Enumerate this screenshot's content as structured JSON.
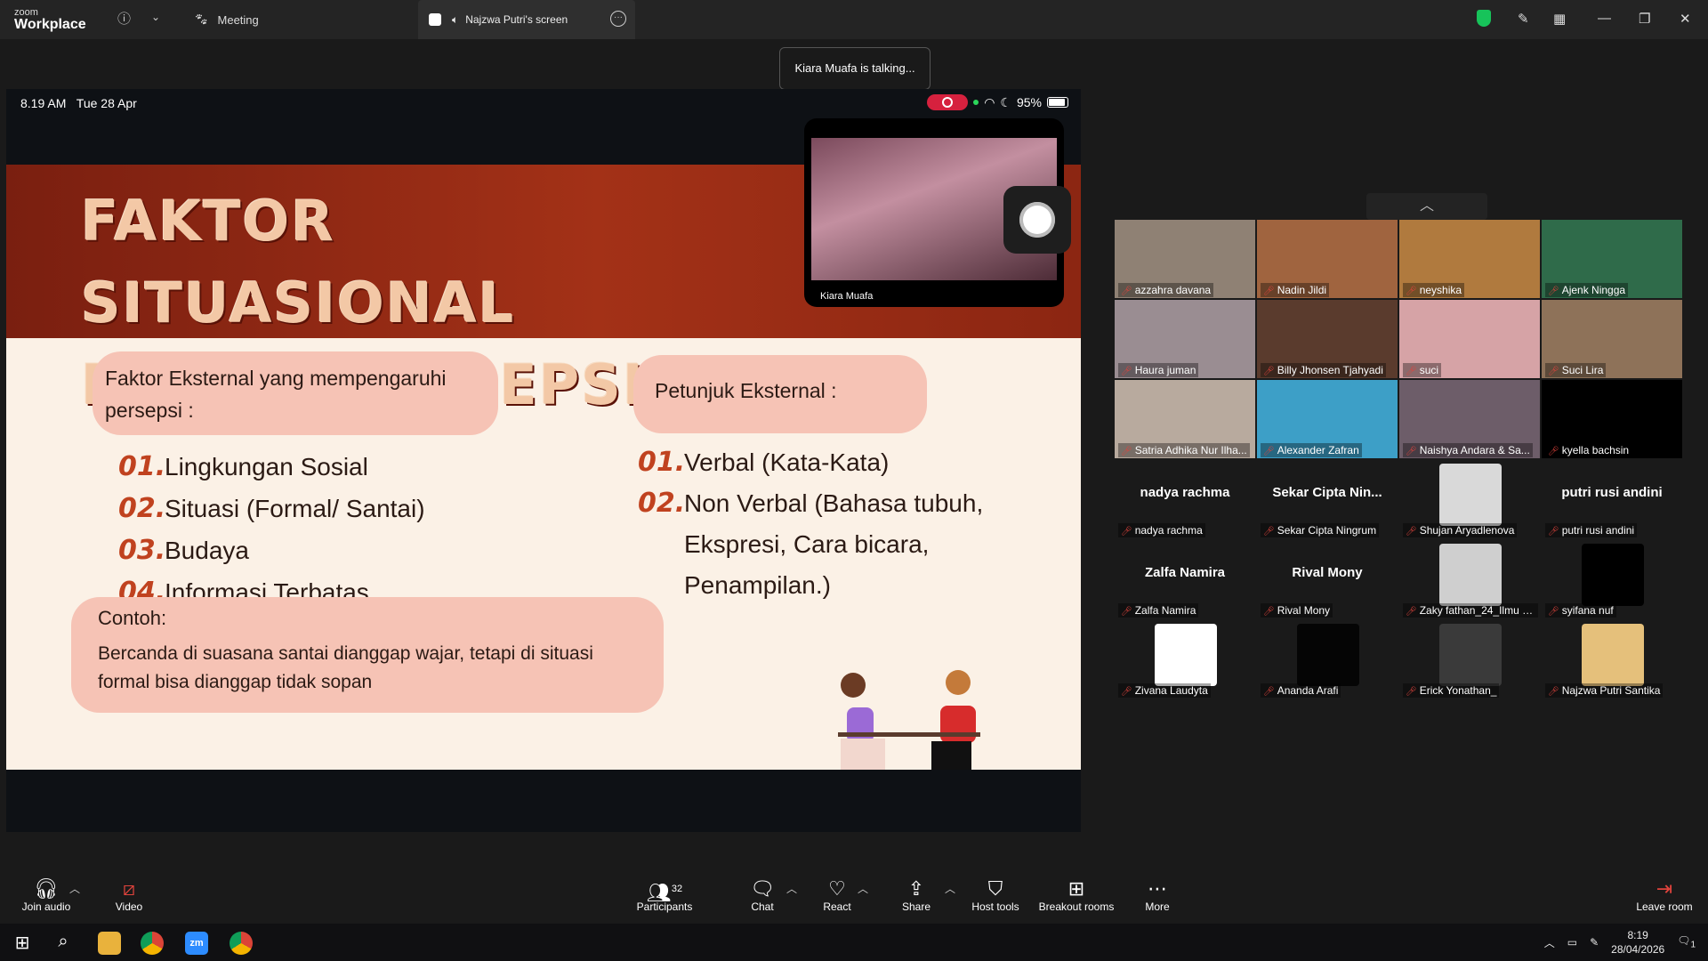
{
  "titlebar": {
    "logo_top": "zoom",
    "logo_bottom": "Workplace",
    "meeting_tab": "Meeting",
    "screen_tab": "Najzwa Putri's screen",
    "info_icon": "info-icon",
    "chevron_icon": "chevron-down-icon"
  },
  "toast": "Kiara Muafa is talking...",
  "share": {
    "time": "8.19 AM",
    "date": "Tue 28 Apr",
    "battery": "95%",
    "slide": {
      "title": "Faktor situasional dalam persepsi",
      "pill_left": "Faktor Eksternal yang mempengaruhi persepsi :",
      "pill_right": "Petunjuk Eksternal :",
      "left_items": [
        {
          "num": "01.",
          "text": "Lingkungan Sosial"
        },
        {
          "num": "02.",
          "text": "Situasi (Formal/ Santai)"
        },
        {
          "num": "03.",
          "text": "Budaya"
        },
        {
          "num": "04.",
          "text": "Informasi Terbatas"
        }
      ],
      "right_items": [
        {
          "num": "01.",
          "text": "Verbal (Kata-Kata)"
        },
        {
          "num": "02.",
          "text": "Non Verbal (Bahasa tubuh, Ekspresi, Cara bicara, Penampilan.)"
        }
      ],
      "example_title": "Contoh:",
      "example_text": "Bercanda di suasana santai dianggap wajar, tetapi di situasi formal bisa dianggap tidak sopan"
    },
    "self_view_name": "Kiara Muafa"
  },
  "gallery": [
    {
      "name": "azzahra davana",
      "big": "",
      "color": "#8f8174"
    },
    {
      "name": "Nadin Jildi",
      "big": "",
      "color": "#a0643f"
    },
    {
      "name": "neyshika",
      "big": "",
      "color": "#b07a3e"
    },
    {
      "name": "Ajenk Ningga",
      "big": "",
      "color": "#2f6b4a"
    },
    {
      "name": "Haura juman",
      "big": "",
      "color": "#9a8d92"
    },
    {
      "name": "Billy Jhonsen Tjahyadi",
      "big": "",
      "color": "#5a3b2d"
    },
    {
      "name": "suci",
      "big": "",
      "color": "#d6a3a6"
    },
    {
      "name": "Suci Lira",
      "big": "",
      "color": "#8e7259"
    },
    {
      "name": "Satria Adhika Nur Ilha...",
      "big": "",
      "color": "#b8aa9e"
    },
    {
      "name": "Alexander Zafran",
      "big": "",
      "color": "#3d9fc7"
    },
    {
      "name": "Naishya Andara & Sa...",
      "big": "",
      "color": "#6d5d69"
    },
    {
      "name": "kyella bachsin",
      "big": "",
      "color": "#000000"
    },
    {
      "name": "nadya rachma",
      "big": "nadya rachma",
      "color": "#000000"
    },
    {
      "name": "Sekar Cipta Ningrum",
      "big": "Sekar Cipta Nin...",
      "color": "#000000"
    },
    {
      "name": "Shujan Aryadlenova",
      "big": "",
      "color": "#000000"
    },
    {
      "name": "putri rusi andini",
      "big": "putri rusi andini",
      "color": "#000000"
    },
    {
      "name": "Zalfa Namira",
      "big": "Zalfa Namira",
      "color": "#000000"
    },
    {
      "name": "Rival Mony",
      "big": "Rival Mony",
      "color": "#000000"
    },
    {
      "name": "Zaky fathan_24_Ilmu K...",
      "big": "",
      "color": "#000000"
    },
    {
      "name": "syifana nuf",
      "big": "",
      "color": "#000000"
    },
    {
      "name": "Zivana Laudyta",
      "big": "",
      "color": "#000000"
    },
    {
      "name": "Ananda Arafi",
      "big": "",
      "color": "#000000"
    },
    {
      "name": "Erick Yonathan_",
      "big": "",
      "color": "#000000"
    },
    {
      "name": "Najzwa Putri Santika",
      "big": "",
      "color": "#000000"
    }
  ],
  "toolbar": {
    "join_audio": "Join audio",
    "video": "Video",
    "participants": "Participants",
    "participants_count": "32",
    "chat": "Chat",
    "react": "React",
    "share": "Share",
    "host_tools": "Host tools",
    "breakout_rooms": "Breakout rooms",
    "more": "More",
    "leave_room": "Leave room"
  },
  "taskbar": {
    "time": "8:19",
    "date": "28/04/2026",
    "notification_count": "1"
  }
}
